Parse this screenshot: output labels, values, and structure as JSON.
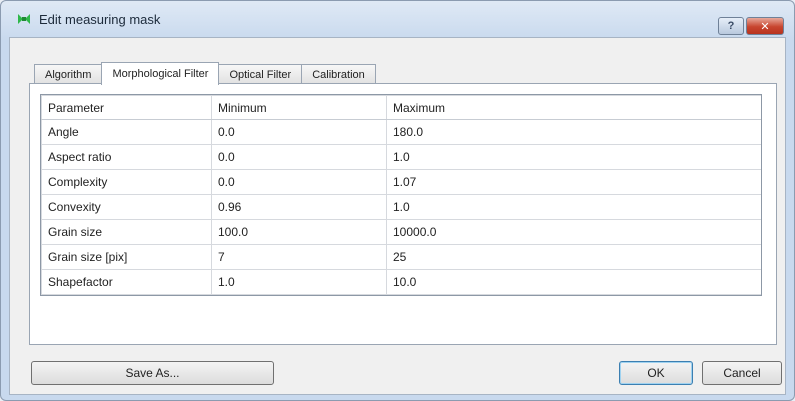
{
  "window": {
    "title": "Edit measuring mask",
    "help_label": "?",
    "close_label": "✕"
  },
  "tabs": [
    {
      "label": "Algorithm",
      "active": false
    },
    {
      "label": "Morphological Filter",
      "active": true
    },
    {
      "label": "Optical Filter",
      "active": false
    },
    {
      "label": "Calibration",
      "active": false
    }
  ],
  "table": {
    "headers": [
      "Parameter",
      "Minimum",
      "Maximum"
    ],
    "rows": [
      [
        "Angle",
        "0.0",
        "180.0"
      ],
      [
        "Aspect ratio",
        "0.0",
        "1.0"
      ],
      [
        "Complexity",
        "0.0",
        "1.07"
      ],
      [
        "Convexity",
        "0.96",
        "1.0"
      ],
      [
        "Grain size",
        "100.0",
        "10000.0"
      ],
      [
        "Grain size [pix]",
        "7",
        "25"
      ],
      [
        "Shapefactor",
        "1.0",
        "10.0"
      ]
    ]
  },
  "buttons": {
    "save_as": "Save As...",
    "ok": "OK",
    "cancel": "Cancel"
  },
  "colors": {
    "app_icon": "#2fb84a",
    "close_button": "#c8452f",
    "ok_focus": "#3c7fb1"
  },
  "icons": {
    "app": "app-icon",
    "help": "help-icon",
    "close": "close-icon"
  }
}
